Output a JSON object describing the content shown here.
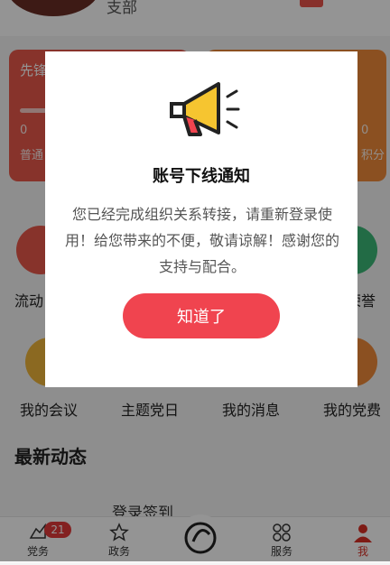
{
  "header": {
    "org_suffix": "支部"
  },
  "cards": {
    "left": {
      "title": "先锋",
      "value": "0",
      "sub": "普通"
    },
    "right": {
      "value": "0",
      "sub": "积分"
    }
  },
  "grid": {
    "row1": [
      "流动",
      "荣誉"
    ],
    "row2": [
      "我的会议",
      "主题党日",
      "我的消息",
      "我的党费"
    ]
  },
  "section": {
    "title": "最新动态",
    "first_item": "登录签到"
  },
  "nav": {
    "items": [
      "党务",
      "政务",
      "服务",
      "我"
    ],
    "badge": "21",
    "active": "我"
  },
  "dialog": {
    "icon": "megaphone-icon",
    "title": "账号下线通知",
    "message": "您已经完成组织关系转接，请重新登录使用！给您带来的不便，敬请谅解！感谢您的支持与配合。",
    "button": "知道了"
  },
  "colors": {
    "accent": "#f0444f",
    "overlay": "rgba(0,0,0,0.42)"
  }
}
